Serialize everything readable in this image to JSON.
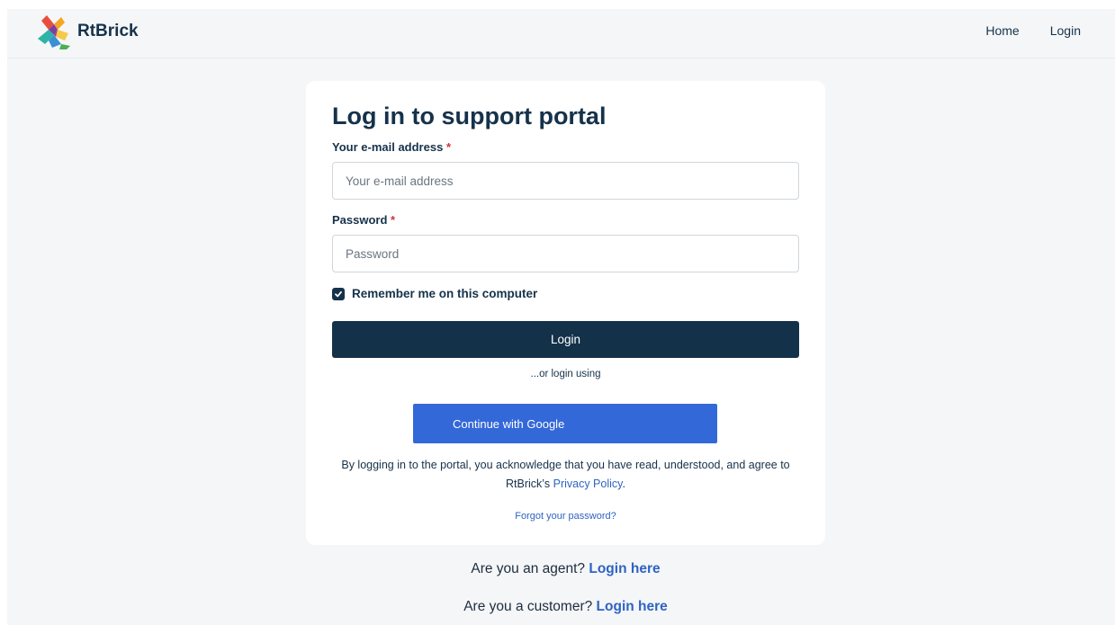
{
  "navbar": {
    "brand_name": "RtBrick",
    "links": [
      "Home",
      "Login"
    ]
  },
  "form": {
    "title": "Log in to support portal",
    "email_label": "Your e-mail address",
    "email_placeholder": "Your e-mail address",
    "password_label": "Password",
    "password_placeholder": "Password",
    "required_marker": "*",
    "remember_label": "Remember me on this computer",
    "remember_checked": true,
    "login_button": "Login",
    "or_text": "...or login using",
    "google_button": "Continue with Google",
    "consent_text": "By logging in to the portal, you acknowledge that you have read, understood, and agree to RtBrick’s",
    "privacy_link": "Privacy Policy",
    "consent_end": ".",
    "forgot_link": "Forgot your password?"
  },
  "footer": {
    "agent_text": "Are you an agent?",
    "agent_link": "Login here",
    "customer_text": "Are you a customer?",
    "customer_link": "Login here"
  },
  "colors": {
    "primary_dark": "#14314a",
    "google_blue": "#3368d8",
    "link_blue": "#2f63c2",
    "background": "#f4f6f8"
  },
  "icons": [
    "rtbrick-logo",
    "check-icon"
  ]
}
